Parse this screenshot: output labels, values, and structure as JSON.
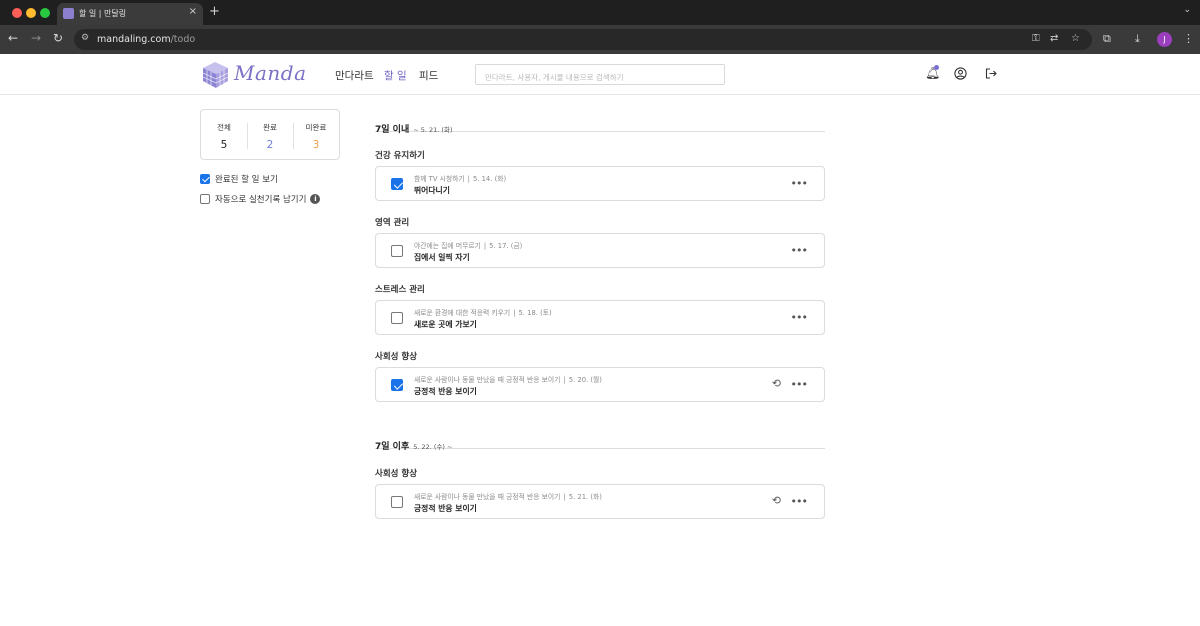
{
  "browser": {
    "tab_title": "할 일 | 만달링",
    "tab_close": "×",
    "new_tab": "+",
    "url_host": "mandaling.com",
    "url_path": "/todo",
    "profile_initial": "J"
  },
  "header": {
    "logo_text": "Manda",
    "nav": [
      {
        "label": "만다라트",
        "active": false
      },
      {
        "label": "할 일",
        "active": true
      },
      {
        "label": "피드",
        "active": false
      }
    ],
    "search_placeholder": "만다라트, 사용자, 게시물 내용으로 검색하기"
  },
  "stats": [
    {
      "label": "전체",
      "value": "5",
      "color": "#222222"
    },
    {
      "label": "완료",
      "value": "2",
      "color": "#6d7fd8"
    },
    {
      "label": "미완료",
      "value": "3",
      "color": "#f0a04b"
    }
  ],
  "options": [
    {
      "label": "완료된 할 일 보기",
      "checked": true
    },
    {
      "label": "자동으로 실천기록 남기기",
      "checked": false
    }
  ],
  "sections": [
    {
      "title": "7일 이내",
      "range": "~ 5. 21. (화)",
      "groups": [
        {
          "goal": "건강 유지하기",
          "todos": [
            {
              "subgoal": "함께 TV 시청하기",
              "date": "5. 14. (화)",
              "title": "뛰어다니기",
              "done": true,
              "repeat": false
            }
          ]
        },
        {
          "goal": "영역 관리",
          "todos": [
            {
              "subgoal": "야간에는 집에 머무르기",
              "date": "5. 17. (금)",
              "title": "집에서 일찍 자기",
              "done": false,
              "repeat": false
            }
          ]
        },
        {
          "goal": "스트레스 관리",
          "todos": [
            {
              "subgoal": "새로운 환경에 대한 적응력 키우기",
              "date": "5. 18. (토)",
              "title": "새로운 곳에 가보기",
              "done": false,
              "repeat": false
            }
          ]
        },
        {
          "goal": "사회성 향상",
          "todos": [
            {
              "subgoal": "새로운 사람이나 동물 만났을 때 긍정적 반응 보이기",
              "date": "5. 20. (월)",
              "title": "긍정적 반응 보이기",
              "done": true,
              "repeat": true
            }
          ]
        }
      ]
    },
    {
      "title": "7일 이후",
      "range": "5. 22. (수) ~",
      "groups": [
        {
          "goal": "사회성 향상",
          "todos": [
            {
              "subgoal": "새로운 사람이나 동물 만났을 때 긍정적 반응 보이기",
              "date": "5. 21. (화)",
              "title": "긍정적 반응 보이기",
              "done": false,
              "repeat": true
            }
          ]
        }
      ]
    }
  ],
  "icons": {
    "more": "more-icon",
    "repeat": "repeat-icon",
    "bell": "bell-icon",
    "user": "user-icon",
    "logout": "logout-icon"
  }
}
